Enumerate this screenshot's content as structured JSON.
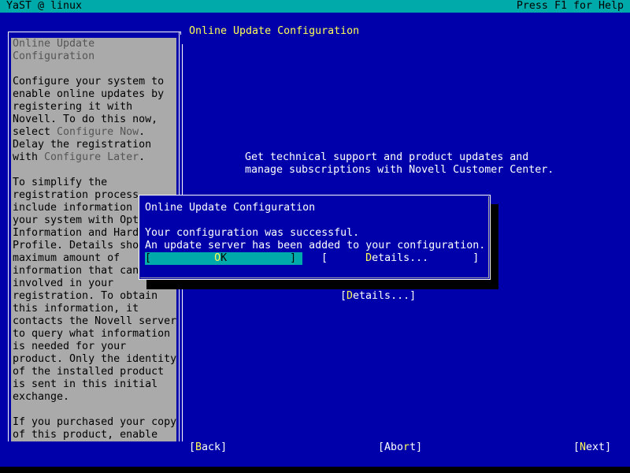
{
  "topbar": {
    "title": "YaST @ linux",
    "help_hint": "Press F1 for Help"
  },
  "help": {
    "title_lines": [
      "Online Update",
      "Configuration"
    ],
    "para1": [
      [
        "Configure your system to"
      ],
      [
        "enable online updates by"
      ],
      [
        "registering it with"
      ],
      [
        "Novell. To do this now,"
      ],
      [
        "select ",
        "Configure Now",
        "."
      ],
      [
        "Delay the registration"
      ],
      [
        "with ",
        "Configure Later",
        "."
      ]
    ],
    "para2": [
      "To simplify the",
      "registration process,",
      "include information about",
      "your system with Optional",
      "Information and Hardware",
      "Profile. Details show the",
      "maximum amount of",
      "information that can be",
      "involved in your",
      "registration. To obtain",
      "this information, it",
      "contacts the Novell server",
      "to query what information",
      "is needed for your",
      "product. Only the identity",
      "of the installed product",
      "is sent in this initial",
      "exchange."
    ],
    "para3": [
      "If you purchased your copy",
      "of this product, enable"
    ]
  },
  "main": {
    "title": "Online Update Configuration",
    "info_line1": "Get technical support and product updates and",
    "info_line2": "manage subscriptions with Novell Customer Center.",
    "details_button": {
      "open": "[",
      "hot": "D",
      "rest": "etails...",
      "close": "]"
    }
  },
  "dialog": {
    "title": "Online Update Configuration",
    "message_line1": "Your configuration was successful.",
    "message_line2": "An update server has been added to your configuration.",
    "ok_button": {
      "open": "[",
      "pad_left": "          ",
      "hot": "O",
      "rest": "K",
      "pad_right": "          ",
      "close": "]"
    },
    "details_button": {
      "open": "[",
      "pad_left": "      ",
      "hot": "D",
      "rest": "etails...",
      "pad_right": "       ",
      "close": "]"
    }
  },
  "footer": {
    "back": {
      "open": "[",
      "hot": "B",
      "rest": "ack",
      "close": "]"
    },
    "abort": {
      "open": "[",
      "pre": "Abo",
      "hot": "r",
      "rest": "t",
      "close": "]"
    },
    "next": {
      "open": "[",
      "hot": "N",
      "rest": "ext",
      "close": "]"
    }
  },
  "colors": {
    "background": "#0000aa",
    "topbar": "#00aaaa",
    "help_panel": "#aaaaaa",
    "hotkey": "#ffff55",
    "title": "#ffff55"
  }
}
